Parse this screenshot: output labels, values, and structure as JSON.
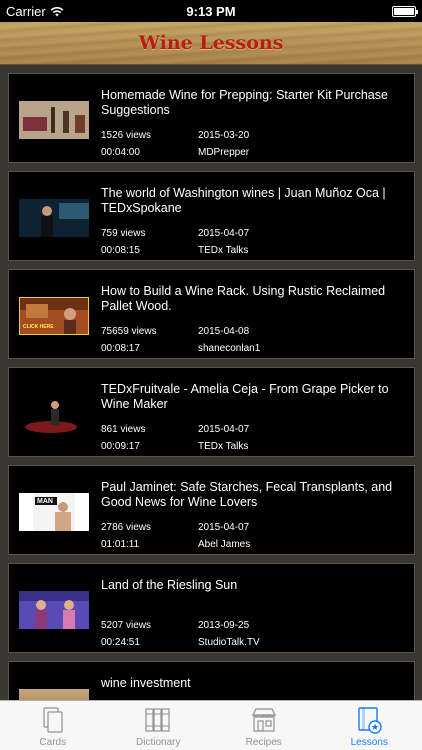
{
  "status_bar": {
    "carrier": "Carrier",
    "time": "9:13 PM",
    "battery_level": 1.0
  },
  "header": {
    "title": "Wine Lessons"
  },
  "lessons": [
    {
      "title": "Homemade Wine for Prepping: Starter Kit Purchase Suggestions",
      "views": "1526 views",
      "date": "2015-03-20",
      "duration": "00:04:00",
      "channel": "MDPrepper"
    },
    {
      "title": "The world of Washington wines | Juan Muñoz Oca | TEDxSpokane",
      "views": "759 views",
      "date": "2015-04-07",
      "duration": "00:08:15",
      "channel": "TEDx Talks"
    },
    {
      "title": "How to Build a Wine Rack. Using Rustic Reclaimed Pallet Wood.",
      "views": "75659 views",
      "date": "2015-04-08",
      "duration": "00:08:17",
      "channel": "shaneconlan1",
      "thumb_text": "CLICK HERE"
    },
    {
      "title": "TEDxFruitvale -  Amelia Ceja - From Grape Picker to Wine Maker",
      "views": "861 views",
      "date": "2015-04-07",
      "duration": "00:09:17",
      "channel": "TEDx Talks"
    },
    {
      "title": "Paul Jaminet: Safe Starches, Fecal Transplants, and Good News for Wine Lovers",
      "views": "2786 views",
      "date": "2015-04-07",
      "duration": "01:01:11",
      "channel": "Abel James",
      "thumb_text": "MAN"
    },
    {
      "title": "Land of the Riesling Sun",
      "views": "5207 views",
      "date": "2013-09-25",
      "duration": "00:24:51",
      "channel": "StudioTalk.TV"
    },
    {
      "title": "wine investment",
      "views": "",
      "date": "",
      "duration": "",
      "channel": ""
    }
  ],
  "tab_bar": {
    "tabs": [
      {
        "label": "Cards",
        "icon": "cards-icon",
        "active": false
      },
      {
        "label": "Dictionary",
        "icon": "books-icon",
        "active": false
      },
      {
        "label": "Recipes",
        "icon": "store-icon",
        "active": false
      },
      {
        "label": "Lessons",
        "icon": "lessons-icon",
        "active": true
      }
    ],
    "active_color": "#1a7cf0",
    "inactive_color": "#929292"
  },
  "colors": {
    "header_title": "#b81d14",
    "card_background": "#000000",
    "page_background": "#3a3631"
  }
}
